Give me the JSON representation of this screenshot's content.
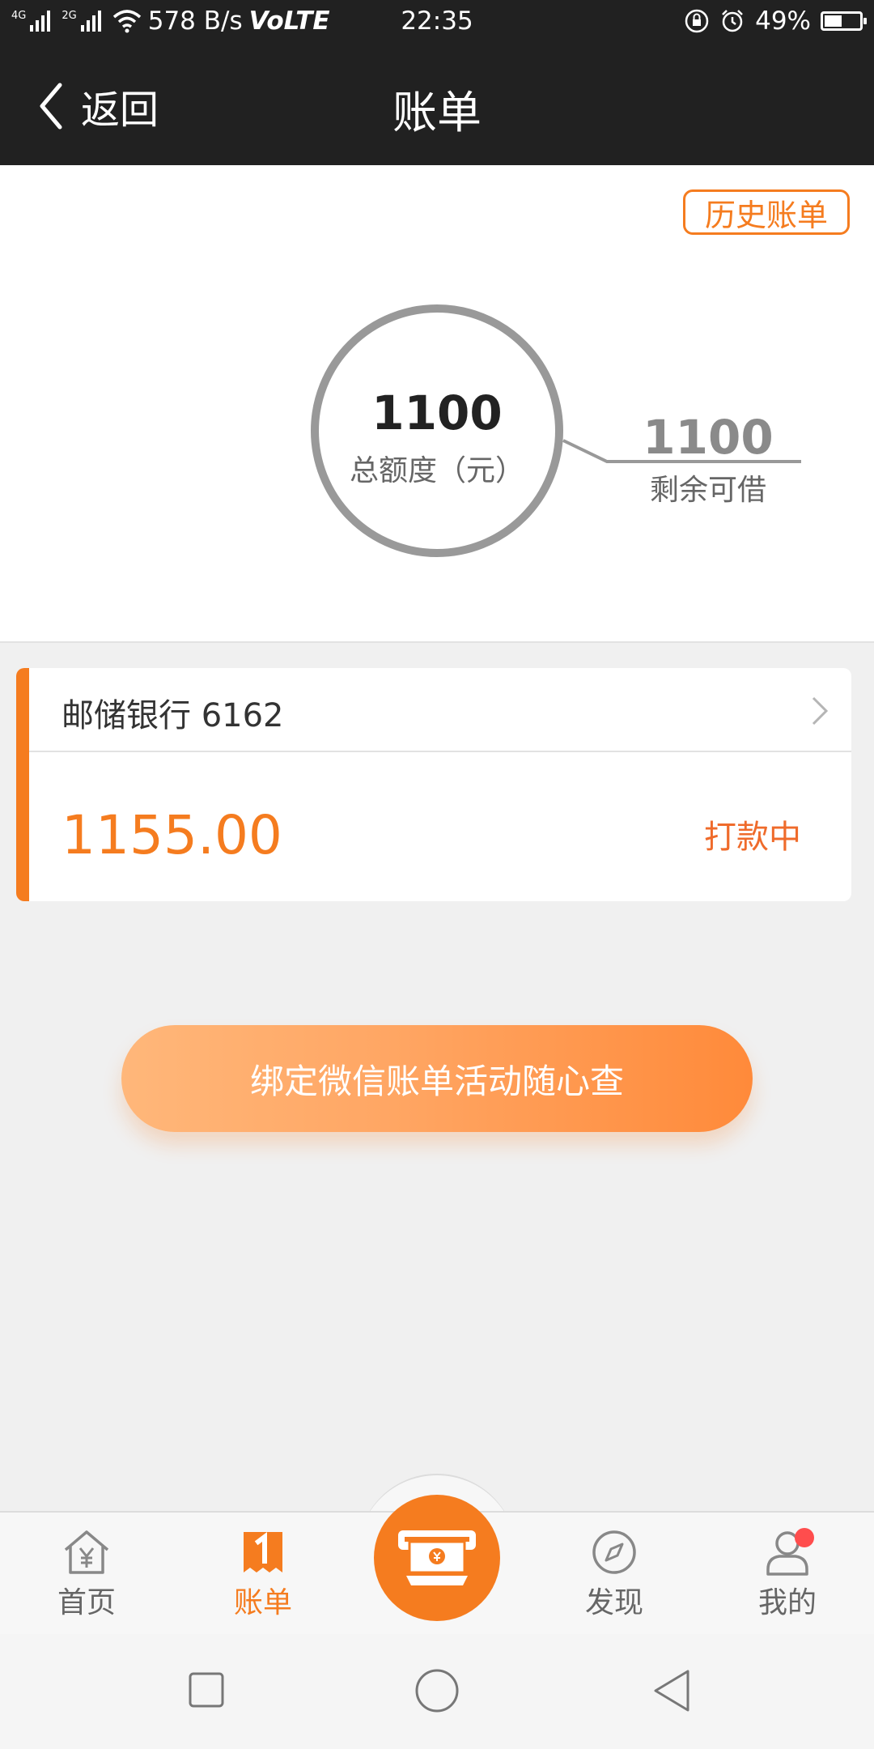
{
  "status_bar": {
    "net1": "4G",
    "net2": "2G",
    "speed": "578 B/s",
    "volte": "VoLTE",
    "time": "22:35",
    "battery": "49%",
    "battery_level": 0.49
  },
  "header": {
    "back_label": "返回",
    "title": "账单"
  },
  "summary": {
    "history_button": "历史账单",
    "total_amount": "1100",
    "total_label": "总额度（元）",
    "remaining_amount": "1100",
    "remaining_label": "剩余可借"
  },
  "bill_card": {
    "bank": "邮储银行 6162",
    "amount": "1155.00",
    "status": "打款中"
  },
  "promo_button": "绑定微信账单活动随心查",
  "tabs": [
    {
      "label": "首页",
      "icon": "home-yen-icon"
    },
    {
      "label": "账单",
      "icon": "bill-icon",
      "active": true
    },
    {
      "label": "",
      "icon": "atm-cash-icon"
    },
    {
      "label": "发现",
      "icon": "compass-icon"
    },
    {
      "label": "我的",
      "icon": "user-icon"
    }
  ],
  "colors": {
    "accent": "#f57c1f",
    "header_bg": "#212121",
    "status_orange": "#ef6b2b"
  }
}
